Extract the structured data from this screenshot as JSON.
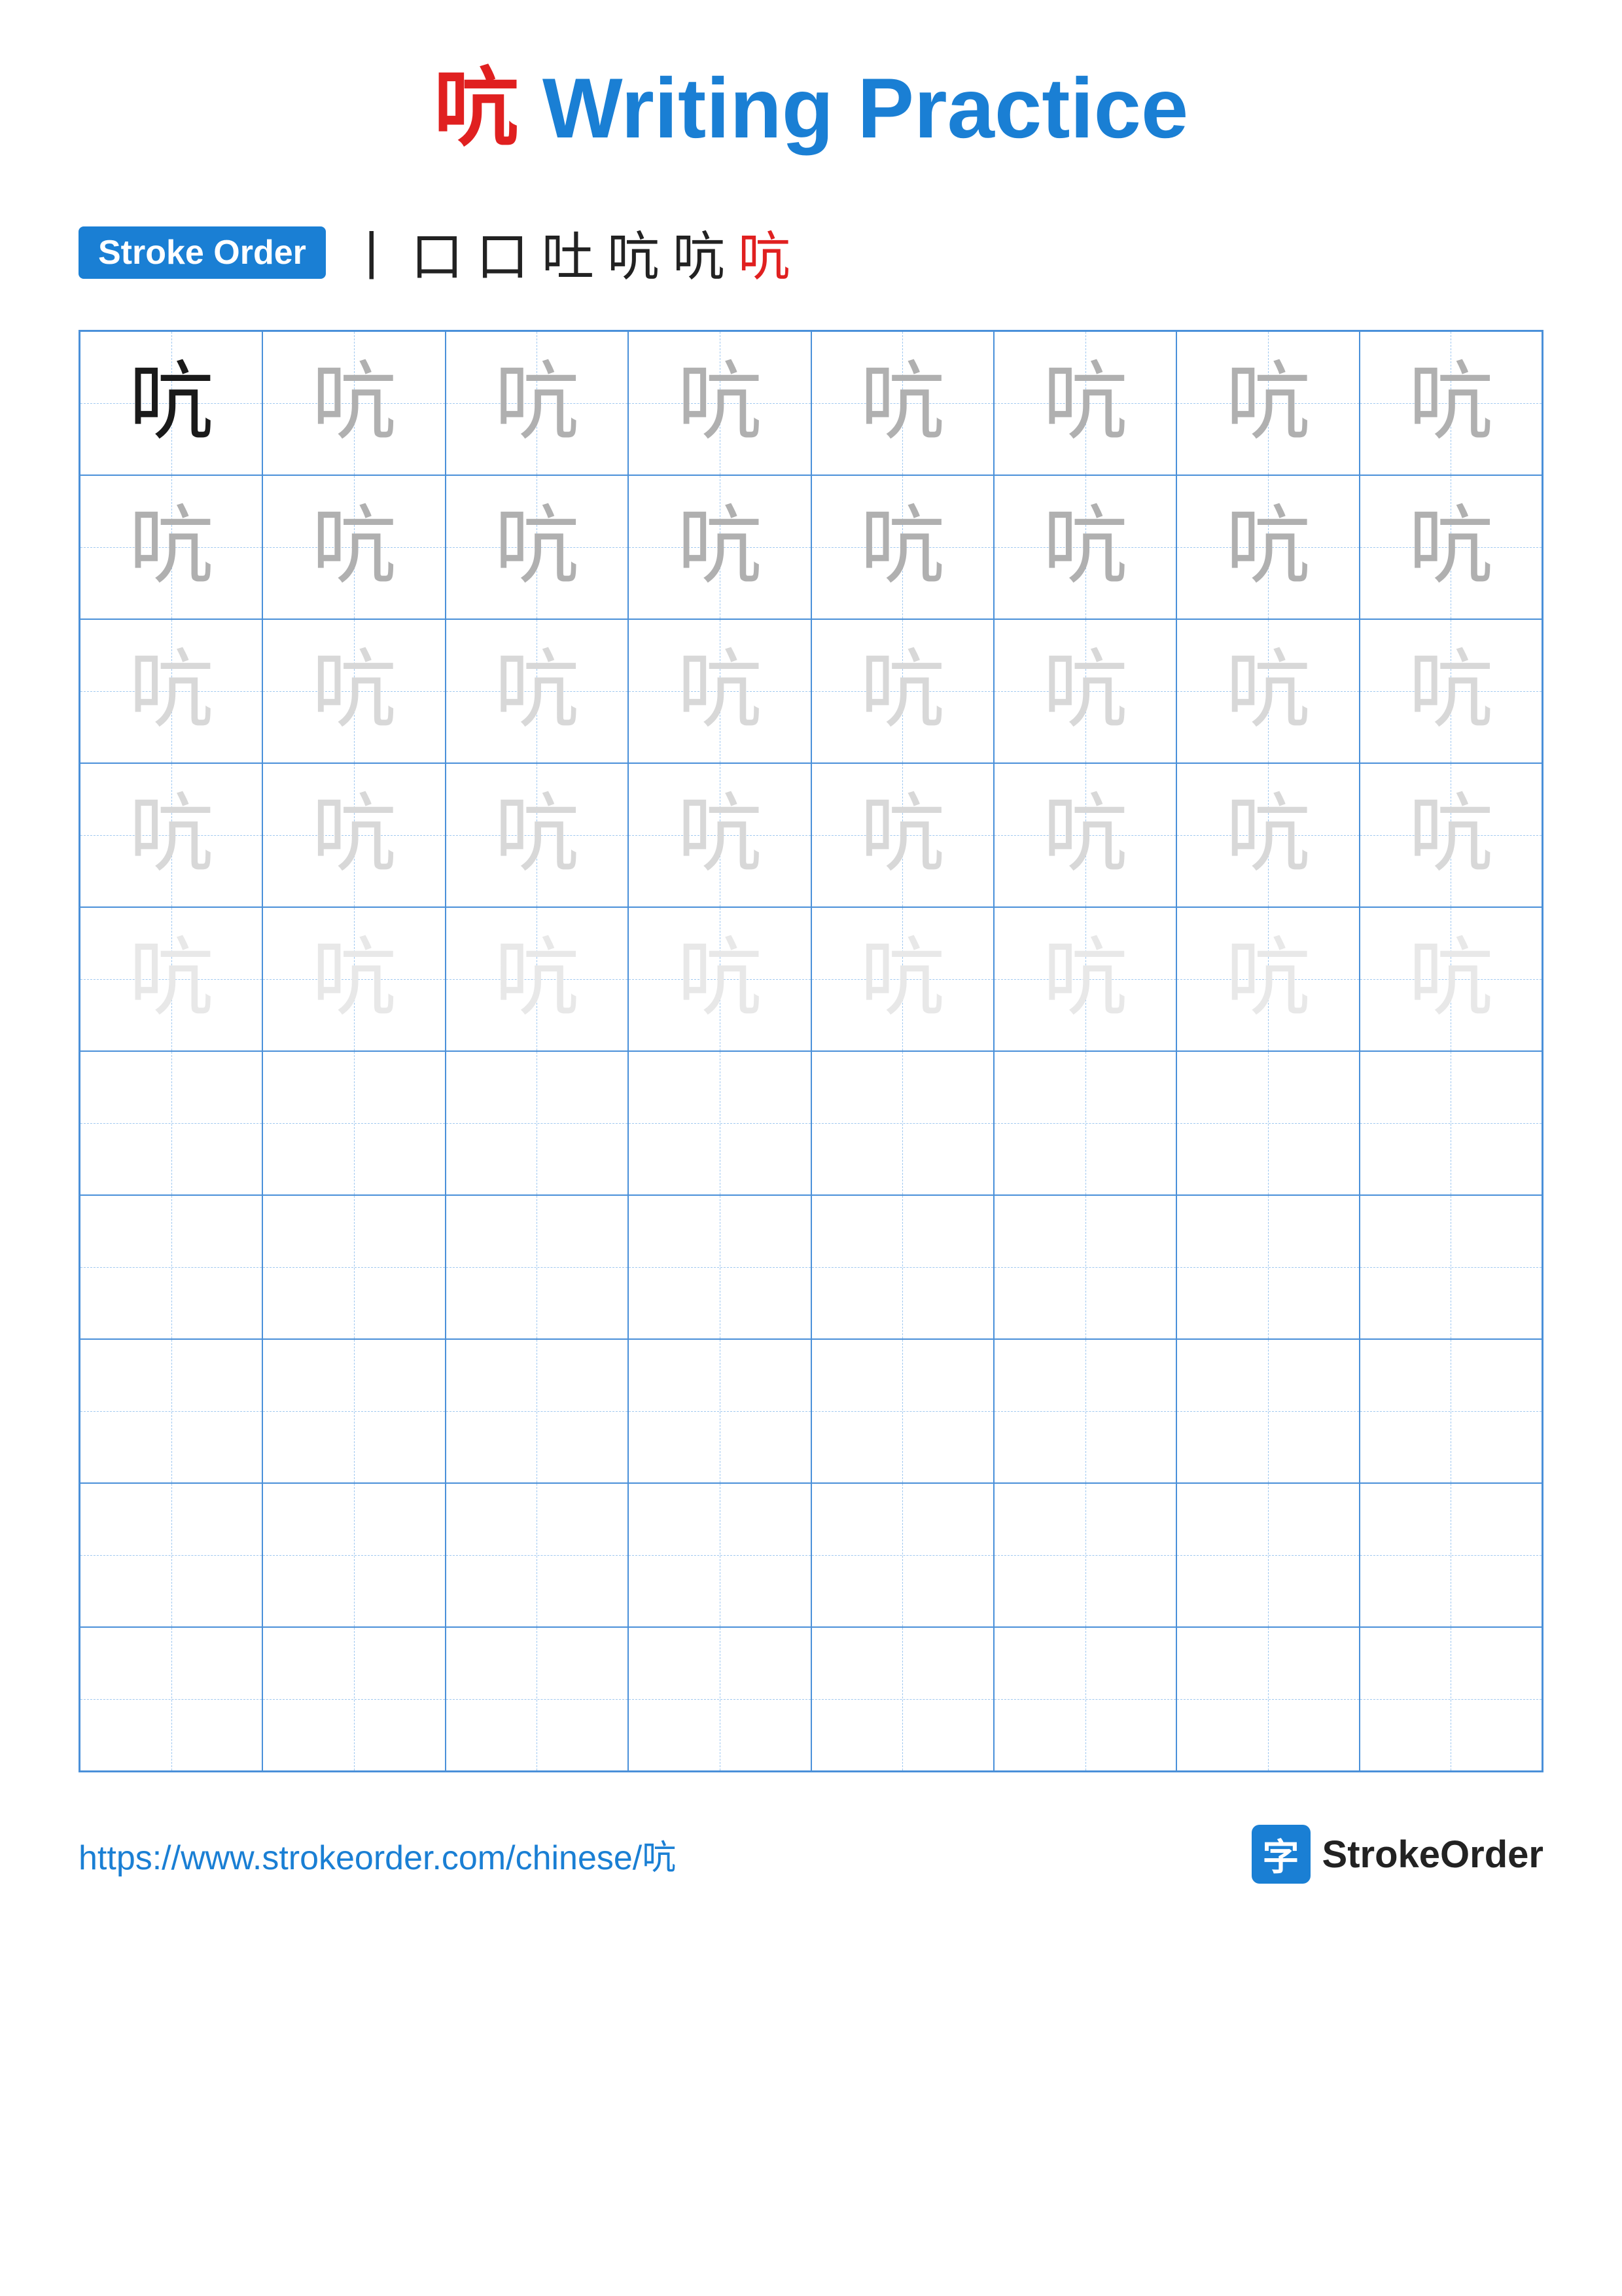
{
  "title": {
    "char": "吭",
    "label": "Writing Practice"
  },
  "stroke_order": {
    "badge_label": "Stroke Order",
    "strokes": [
      "丨",
      "口",
      "口",
      "吐",
      "吭",
      "吭",
      "吭"
    ]
  },
  "grid": {
    "rows": 10,
    "cols": 8,
    "char": "吭",
    "filled_rows": 5
  },
  "footer": {
    "url": "https://www.strokeorder.com/chinese/吭",
    "brand": "StrokeOrder",
    "brand_char": "字"
  }
}
